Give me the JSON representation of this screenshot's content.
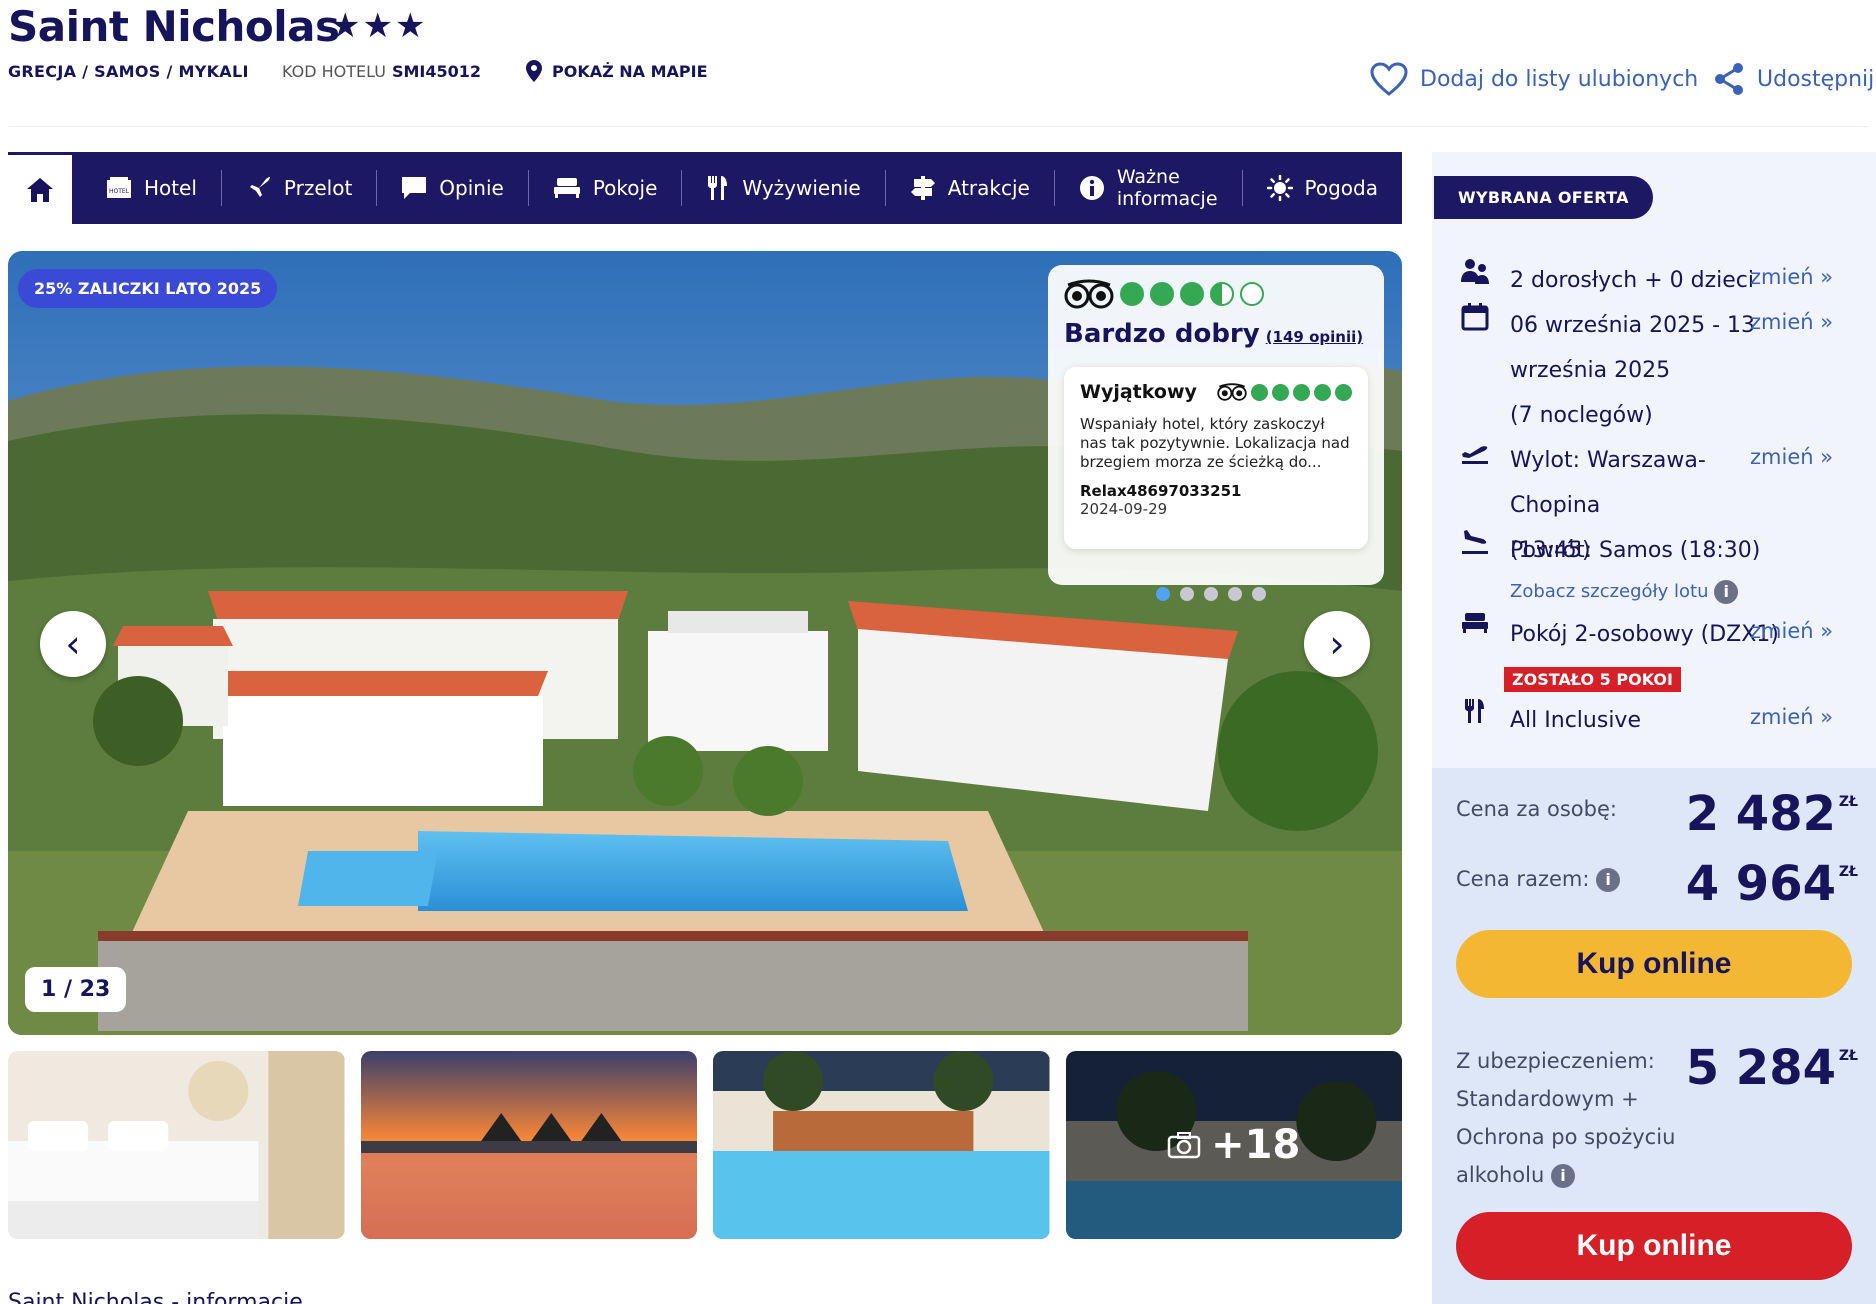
{
  "header": {
    "title": "Saint Nicholas",
    "stars": "★★★",
    "breadcrumb": "GRECJA / SAMOS / MYKALI",
    "hotel_code_label": "KOD HOTELU",
    "hotel_code": "SMI45012",
    "map_link": "POKAŻ NA MAPIE",
    "favorite": "Dodaj do listy ulubionych",
    "share": "Udostępnij"
  },
  "nav": {
    "items": [
      {
        "label": "Hotel",
        "icon": "hotel-icon"
      },
      {
        "label": "Przelot",
        "icon": "plane-icon"
      },
      {
        "label": "Opinie",
        "icon": "comment-icon"
      },
      {
        "label": "Pokoje",
        "icon": "bed-icon"
      },
      {
        "label": "Wyżywienie",
        "icon": "cutlery-icon"
      },
      {
        "label": "Atrakcje",
        "icon": "signpost-icon"
      },
      {
        "label_line1": "Ważne",
        "label_line2": "informacje",
        "icon": "info-icon"
      },
      {
        "label": "Pogoda",
        "icon": "sun-icon"
      }
    ]
  },
  "gallery": {
    "promo": "25% ZALICZKI LATO 2025",
    "counter": "1 / 23",
    "more_photos": "+18"
  },
  "rating": {
    "score_dots": 3.5,
    "label": "Bardzo dobry",
    "reviews_link": "(149 opinii)",
    "review": {
      "title": "Wyjątkowy",
      "text": "Wspaniały hotel, który zaskoczył nas tak pozytywnie. Lokalizacja nad brzegiem morza ze ścieżką do...",
      "user": "Relax48697033251",
      "date": "2024-09-29"
    }
  },
  "sidebar": {
    "badge": "WYBRANA OFERTA",
    "change": "zmień »",
    "guests": "2 dorosłych + 0 dzieci",
    "dates_line1": "06 września 2025 - 13",
    "dates_line2": "września 2025",
    "dates_line3": "(7 noclegów)",
    "departure_line1": "Wylot: Warszawa-Chopina",
    "departure_line2": "(13:45)",
    "return": "Powrót: Samos (18:30)",
    "flight_details": "Zobacz szczegóły lotu",
    "room": "Pokój 2-osobowy (DZX1)",
    "rooms_left": "ZOSTAŁO 5 POKOI",
    "board": "All Inclusive"
  },
  "price": {
    "per_person_label": "Cena za osobę:",
    "per_person": "2 482",
    "total_label": "Cena razem:",
    "total": "4 964",
    "currency": "ZŁ",
    "buy": "Kup online",
    "insurance_line1": "Z ubezpieczeniem:",
    "insurance_line2": "Standardowym +",
    "insurance_line3": "Ochrona po spożyciu",
    "insurance_line4": "alkoholu",
    "insured_total": "5 284",
    "buy2": "Kup online"
  },
  "footer": {
    "text": "Saint Nicholas - informacje"
  },
  "colors": {
    "brand": "#1d1864",
    "link": "#3a62b8",
    "buy_yellow": "#f4b733",
    "buy_red": "#d61f26",
    "tripadvisor_green": "#34a853"
  }
}
